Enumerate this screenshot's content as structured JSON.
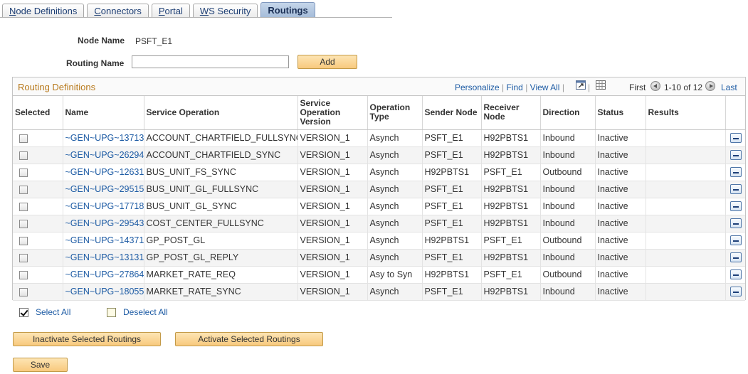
{
  "tabs": [
    {
      "label": "Node Definitions",
      "mnemonic": "N",
      "rest": "ode Definitions"
    },
    {
      "label": "Connectors",
      "mnemonic": "C",
      "rest": "onnectors"
    },
    {
      "label": "Portal",
      "mnemonic": "P",
      "rest": "ortal"
    },
    {
      "label": "WS Security",
      "mnemonic": "W",
      "rest": "S Security"
    },
    {
      "label": "Routings",
      "active": true
    }
  ],
  "form": {
    "node_name_label": "Node Name",
    "node_name_value": "PSFT_E1",
    "routing_name_label": "Routing Name",
    "routing_name_value": "",
    "add_label": "Add"
  },
  "grid": {
    "title": "Routing Definitions",
    "personalize": "Personalize",
    "find": "Find",
    "view_all": "View All",
    "separator": "|",
    "first": "First",
    "range": "1-10 of 12",
    "last": "Last",
    "columns": [
      "Selected",
      "Name",
      "Service Operation",
      "Service Operation Version",
      "Operation Type",
      "Sender Node",
      "Receiver Node",
      "Direction",
      "Status",
      "Results",
      ""
    ],
    "rows": [
      {
        "name": "~GEN~UPG~13713",
        "service_operation": "ACCOUNT_CHARTFIELD_FULLSYNC",
        "version": "VERSION_1",
        "type": "Asynch",
        "sender": "PSFT_E1",
        "receiver": "H92PBTS1",
        "direction": "Inbound",
        "status": "Inactive",
        "results": ""
      },
      {
        "name": "~GEN~UPG~26294",
        "service_operation": "ACCOUNT_CHARTFIELD_SYNC",
        "version": "VERSION_1",
        "type": "Asynch",
        "sender": "PSFT_E1",
        "receiver": "H92PBTS1",
        "direction": "Inbound",
        "status": "Inactive",
        "results": ""
      },
      {
        "name": "~GEN~UPG~12631",
        "service_operation": "BUS_UNIT_FS_SYNC",
        "version": "VERSION_1",
        "type": "Asynch",
        "sender": "H92PBTS1",
        "receiver": "PSFT_E1",
        "direction": "Outbound",
        "status": "Inactive",
        "results": ""
      },
      {
        "name": "~GEN~UPG~29515",
        "service_operation": "BUS_UNIT_GL_FULLSYNC",
        "version": "VERSION_1",
        "type": "Asynch",
        "sender": "PSFT_E1",
        "receiver": "H92PBTS1",
        "direction": "Inbound",
        "status": "Inactive",
        "results": ""
      },
      {
        "name": "~GEN~UPG~17718",
        "service_operation": "BUS_UNIT_GL_SYNC",
        "version": "VERSION_1",
        "type": "Asynch",
        "sender": "PSFT_E1",
        "receiver": "H92PBTS1",
        "direction": "Inbound",
        "status": "Inactive",
        "results": ""
      },
      {
        "name": "~GEN~UPG~29543",
        "service_operation": "COST_CENTER_FULLSYNC",
        "version": "VERSION_1",
        "type": "Asynch",
        "sender": "PSFT_E1",
        "receiver": "H92PBTS1",
        "direction": "Inbound",
        "status": "Inactive",
        "results": ""
      },
      {
        "name": "~GEN~UPG~14371",
        "service_operation": "GP_POST_GL",
        "version": "VERSION_1",
        "type": "Asynch",
        "sender": "H92PBTS1",
        "receiver": "PSFT_E1",
        "direction": "Outbound",
        "status": "Inactive",
        "results": ""
      },
      {
        "name": "~GEN~UPG~13131",
        "service_operation": "GP_POST_GL_REPLY",
        "version": "VERSION_1",
        "type": "Asynch",
        "sender": "PSFT_E1",
        "receiver": "H92PBTS1",
        "direction": "Inbound",
        "status": "Inactive",
        "results": ""
      },
      {
        "name": "~GEN~UPG~27864",
        "service_operation": "MARKET_RATE_REQ",
        "version": "VERSION_1",
        "type": "Asy to Syn",
        "sender": "H92PBTS1",
        "receiver": "PSFT_E1",
        "direction": "Outbound",
        "status": "Inactive",
        "results": ""
      },
      {
        "name": "~GEN~UPG~18055",
        "service_operation": "MARKET_RATE_SYNC",
        "version": "VERSION_1",
        "type": "Asynch",
        "sender": "PSFT_E1",
        "receiver": "H92PBTS1",
        "direction": "Inbound",
        "status": "Inactive",
        "results": ""
      }
    ]
  },
  "select_all_label": "Select All",
  "deselect_all_label": "Deselect All",
  "buttons": {
    "inactivate": "Inactivate Selected Routings",
    "activate": "Activate Selected Routings",
    "save": "Save"
  },
  "icons": {
    "zoom": "zoom-icon",
    "download": "download-grid-icon",
    "prev": "previous-page-icon",
    "next": "next-page-icon",
    "delete_row": "delete-row-icon"
  },
  "colors": {
    "link": "#1d5ba4",
    "grid_title": "#b87a1d",
    "button_fill": "#f8c97d",
    "active_tab": "#a4bbd8"
  }
}
